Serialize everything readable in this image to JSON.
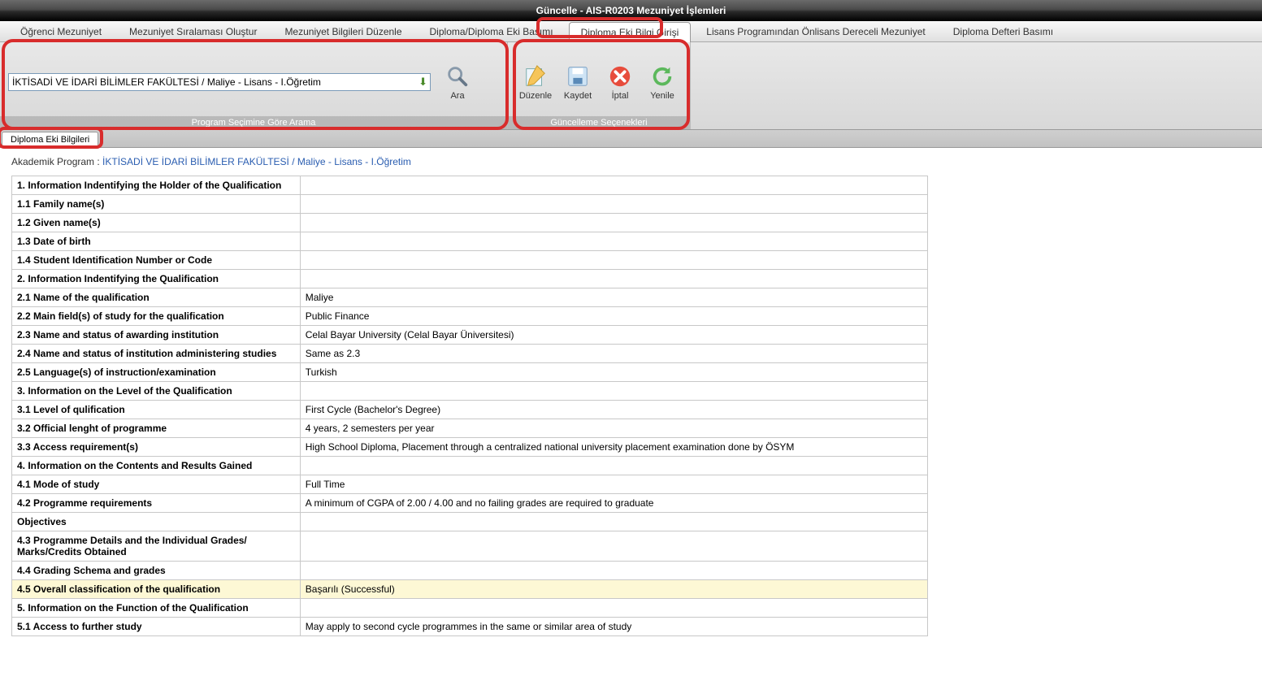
{
  "window": {
    "title": "Güncelle - AIS-R0203 Mezuniyet İşlemleri"
  },
  "tabs": [
    {
      "label": "Öğrenci Mezuniyet",
      "active": false
    },
    {
      "label": "Mezuniyet Sıralaması Oluştur",
      "active": false
    },
    {
      "label": "Mezuniyet Bilgileri Düzenle",
      "active": false
    },
    {
      "label": "Diploma/Diploma Eki Basımı",
      "active": false
    },
    {
      "label": "Diploma Eki Bilgi Girişi",
      "active": true
    },
    {
      "label": "Lisans Programından Önlisans Dereceli Mezuniyet",
      "active": false
    },
    {
      "label": "Diploma Defteri Basımı",
      "active": false
    }
  ],
  "ribbon": {
    "search_group": {
      "label": "Program Seçimine Göre Arama",
      "program_value": "İKTİSADİ VE İDARİ BİLİMLER FAKÜLTESİ / Maliye - Lisans - I.Öğretim",
      "search_label": "Ara"
    },
    "update_group": {
      "label": "Güncelleme Seçenekleri",
      "edit_label": "Düzenle",
      "save_label": "Kaydet",
      "cancel_label": "İptal",
      "refresh_label": "Yenile"
    }
  },
  "sub_tab": {
    "label": "Diploma Eki Bilgileri"
  },
  "program_line": {
    "prefix": "Akademik Program : ",
    "link": "İKTİSADİ VE İDARİ BİLİMLER FAKÜLTESİ / Maliye - Lisans - I.Öğretim"
  },
  "rows": [
    {
      "label": "1.   Information Indentifying the Holder of the Qualification",
      "value": "",
      "section": true
    },
    {
      "label": "1.1 Family name(s)",
      "value": ""
    },
    {
      "label": "1.2 Given name(s)",
      "value": ""
    },
    {
      "label": "1.3 Date of birth",
      "value": ""
    },
    {
      "label": "1.4 Student Identification Number or Code",
      "value": ""
    },
    {
      "label": "2.   Information Indentifying the Qualification",
      "value": "",
      "section": true
    },
    {
      "label": "2.1 Name of the qualification",
      "value": "Maliye"
    },
    {
      "label": "2.2 Main field(s) of study for the qualification",
      "value": "Public Finance"
    },
    {
      "label": "2.3 Name and status of awarding institution",
      "value": "Celal Bayar University (Celal Bayar Üniversitesi)"
    },
    {
      "label": "2.4 Name and status of institution administering studies",
      "value": "Same as 2.3"
    },
    {
      "label": "2.5 Language(s) of instruction/examination",
      "value": "Turkish"
    },
    {
      "label": "3.   Information on the Level of the Qualification",
      "value": "",
      "section": true
    },
    {
      "label": "3.1 Level of qulification",
      "value": "First Cycle (Bachelor's Degree)"
    },
    {
      "label": "3.2 Official lenght of programme",
      "value": "4 years, 2 semesters per year"
    },
    {
      "label": "3.3 Access requirement(s)",
      "value": "High School Diploma, Placement through a centralized national university placement examination done by ÖSYM"
    },
    {
      "label": "4. Information on the Contents and Results Gained",
      "value": "",
      "section": true
    },
    {
      "label": "4.1 Mode of study",
      "value": "Full Time"
    },
    {
      "label": "4.2 Programme requirements",
      "value": "A minimum of CGPA of 2.00 / 4.00 and no failing grades are required to graduate"
    },
    {
      "label": "Objectives",
      "value": "",
      "section": true
    },
    {
      "label": "4.3 Programme Details and the Individual Grades/ Marks/Credits Obtained",
      "value": ""
    },
    {
      "label": "4.4 Grading Schema and grades",
      "value": ""
    },
    {
      "label": "4.5 Overall classification of the qualification",
      "value": "Başarılı (Successful)",
      "highlighted": true
    },
    {
      "label": "5.   Information on the Function of the Qualification",
      "value": "",
      "section": true
    },
    {
      "label": "5.1 Access to further study",
      "value": "May apply to second cycle programmes in the same or similar area of study"
    }
  ]
}
